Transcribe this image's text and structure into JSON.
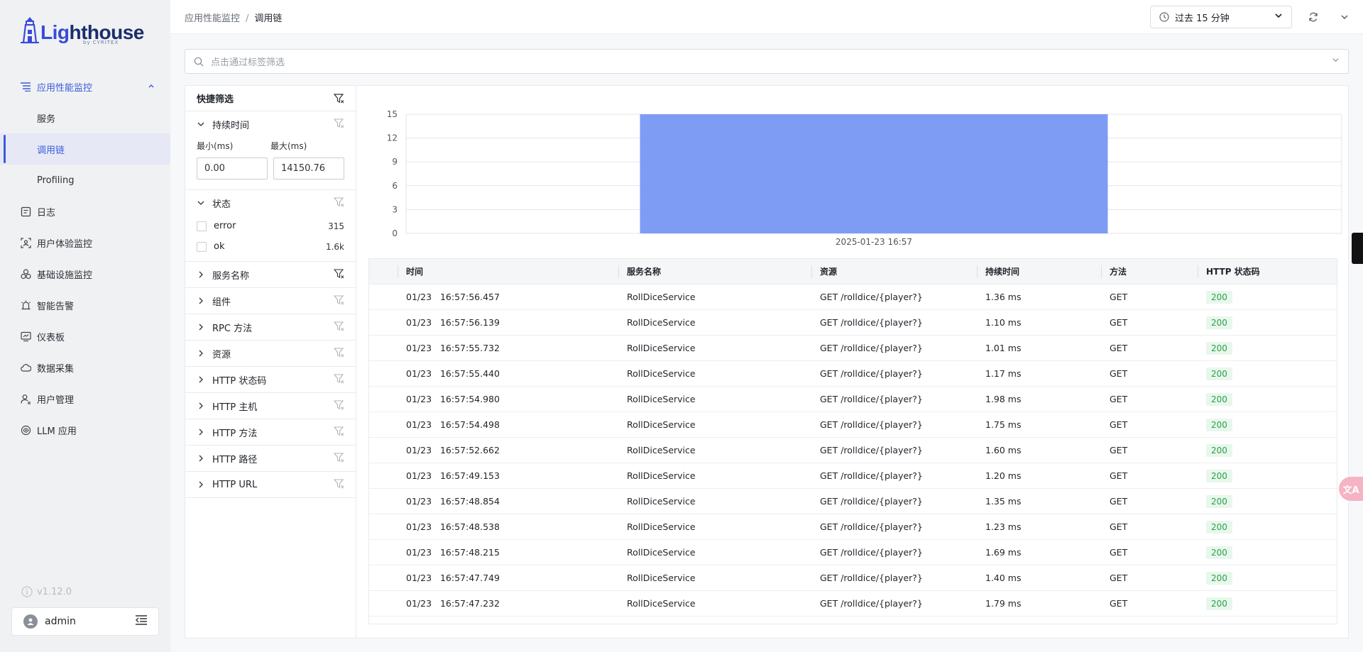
{
  "brand": {
    "name_first": "Lig",
    "name_rest": "hthouse",
    "sub": "by CYRITEX"
  },
  "sidebar": {
    "apm": {
      "label": "应用性能监控",
      "icon": "list-tree-icon"
    },
    "apm_children": [
      {
        "label": "服务",
        "active": false
      },
      {
        "label": "调用链",
        "active": true
      },
      {
        "label": "Profiling",
        "active": false
      }
    ],
    "items": [
      {
        "label": "日志",
        "icon": "log-icon"
      },
      {
        "label": "用户体验监控",
        "icon": "user-scan-icon"
      },
      {
        "label": "基础设施监控",
        "icon": "infra-icon"
      },
      {
        "label": "智能告警",
        "icon": "alarm-icon"
      },
      {
        "label": "仪表板",
        "icon": "dashboard-icon"
      },
      {
        "label": "数据采集",
        "icon": "cloud-icon"
      },
      {
        "label": "用户管理",
        "icon": "user-manage-icon"
      },
      {
        "label": "LLM 应用",
        "icon": "llm-icon"
      }
    ],
    "version": "v1.12.0",
    "user": "admin"
  },
  "header": {
    "breadcrumb_root": "应用性能监控",
    "breadcrumb_sep": "/",
    "breadcrumb_current": "调用链",
    "time_range": "过去 15 分钟"
  },
  "search": {
    "placeholder": "点击通过标签筛选"
  },
  "filters": {
    "title": "快捷筛选",
    "duration": {
      "title": "持续时间",
      "min_label": "最小(ms)",
      "max_label": "最大(ms)",
      "min_value": "0.00",
      "max_value": "14150.76"
    },
    "status": {
      "title": "状态",
      "options": [
        {
          "label": "error",
          "count": "315"
        },
        {
          "label": "ok",
          "count": "1.6k"
        }
      ]
    },
    "collapsed": [
      "服务名称",
      "组件",
      "RPC 方法",
      "资源",
      "HTTP 状态码",
      "HTTP 主机",
      "HTTP 方法",
      "HTTP 路径",
      "HTTP URL"
    ]
  },
  "chart_data": {
    "type": "bar",
    "categories": [
      "2025-01-23 16:57"
    ],
    "values": [
      15
    ],
    "ylim": [
      0,
      15
    ],
    "yticks": [
      0,
      3,
      6,
      9,
      12,
      15
    ],
    "bar_color": "#7f9cf5",
    "grid": true
  },
  "table": {
    "columns": [
      "时间",
      "服务名称",
      "资源",
      "持续时间",
      "方法",
      "HTTP 状态码"
    ],
    "rows": [
      {
        "date": "01/23",
        "time": "16:57:56.457",
        "service": "RollDiceService",
        "resource": "GET /rolldice/{player?}",
        "duration": "1.36 ms",
        "method": "GET",
        "status": "200"
      },
      {
        "date": "01/23",
        "time": "16:57:56.139",
        "service": "RollDiceService",
        "resource": "GET /rolldice/{player?}",
        "duration": "1.10 ms",
        "method": "GET",
        "status": "200"
      },
      {
        "date": "01/23",
        "time": "16:57:55.732",
        "service": "RollDiceService",
        "resource": "GET /rolldice/{player?}",
        "duration": "1.01 ms",
        "method": "GET",
        "status": "200"
      },
      {
        "date": "01/23",
        "time": "16:57:55.440",
        "service": "RollDiceService",
        "resource": "GET /rolldice/{player?}",
        "duration": "1.17 ms",
        "method": "GET",
        "status": "200"
      },
      {
        "date": "01/23",
        "time": "16:57:54.980",
        "service": "RollDiceService",
        "resource": "GET /rolldice/{player?}",
        "duration": "1.98 ms",
        "method": "GET",
        "status": "200"
      },
      {
        "date": "01/23",
        "time": "16:57:54.498",
        "service": "RollDiceService",
        "resource": "GET /rolldice/{player?}",
        "duration": "1.75 ms",
        "method": "GET",
        "status": "200"
      },
      {
        "date": "01/23",
        "time": "16:57:52.662",
        "service": "RollDiceService",
        "resource": "GET /rolldice/{player?}",
        "duration": "1.60 ms",
        "method": "GET",
        "status": "200"
      },
      {
        "date": "01/23",
        "time": "16:57:49.153",
        "service": "RollDiceService",
        "resource": "GET /rolldice/{player?}",
        "duration": "1.20 ms",
        "method": "GET",
        "status": "200"
      },
      {
        "date": "01/23",
        "time": "16:57:48.854",
        "service": "RollDiceService",
        "resource": "GET /rolldice/{player?}",
        "duration": "1.35 ms",
        "method": "GET",
        "status": "200"
      },
      {
        "date": "01/23",
        "time": "16:57:48.538",
        "service": "RollDiceService",
        "resource": "GET /rolldice/{player?}",
        "duration": "1.23 ms",
        "method": "GET",
        "status": "200"
      },
      {
        "date": "01/23",
        "time": "16:57:48.215",
        "service": "RollDiceService",
        "resource": "GET /rolldice/{player?}",
        "duration": "1.69 ms",
        "method": "GET",
        "status": "200"
      },
      {
        "date": "01/23",
        "time": "16:57:47.749",
        "service": "RollDiceService",
        "resource": "GET /rolldice/{player?}",
        "duration": "1.40 ms",
        "method": "GET",
        "status": "200"
      },
      {
        "date": "01/23",
        "time": "16:57:47.232",
        "service": "RollDiceService",
        "resource": "GET /rolldice/{player?}",
        "duration": "1.79 ms",
        "method": "GET",
        "status": "200"
      }
    ]
  },
  "floaters": {
    "translate_glyph": "文A"
  },
  "colors": {
    "accent": "#3b5bdb",
    "status_ok_bg": "#e8f7ec",
    "status_ok_text": "#2ba04a"
  }
}
